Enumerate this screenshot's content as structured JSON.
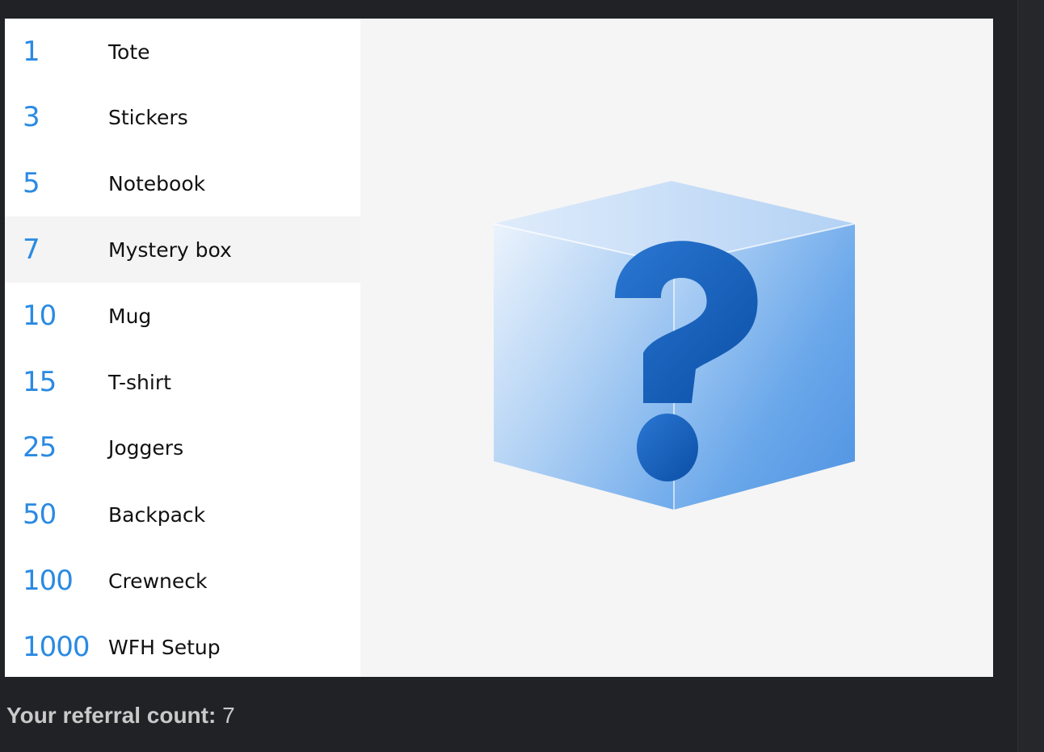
{
  "tiers": [
    {
      "count": "1",
      "reward": "Tote"
    },
    {
      "count": "3",
      "reward": "Stickers"
    },
    {
      "count": "5",
      "reward": "Notebook"
    },
    {
      "count": "7",
      "reward": "Mystery box"
    },
    {
      "count": "10",
      "reward": "Mug"
    },
    {
      "count": "15",
      "reward": "T-shirt"
    },
    {
      "count": "25",
      "reward": "Joggers"
    },
    {
      "count": "50",
      "reward": "Backpack"
    },
    {
      "count": "100",
      "reward": "Crewneck"
    },
    {
      "count": "1000",
      "reward": "WFH Setup"
    }
  ],
  "highlighted_tier": "7",
  "referral": {
    "label": "Your referral count:",
    "value": "7"
  },
  "image": {
    "icon": "mystery-box-question-icon"
  },
  "colors": {
    "accent": "#2a8ae3",
    "background": "#212226",
    "card": "#ffffff",
    "highlight_row": "#f4f4f4"
  }
}
